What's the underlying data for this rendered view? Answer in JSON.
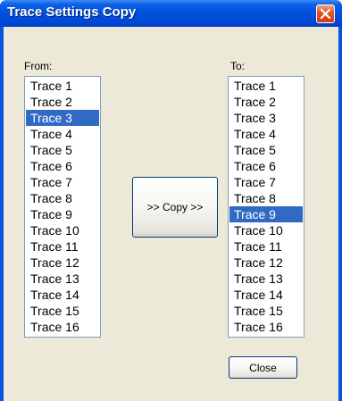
{
  "window": {
    "title": "Trace Settings Copy"
  },
  "from": {
    "label": "From:",
    "items": [
      "Trace 1",
      "Trace 2",
      "Trace 3",
      "Trace 4",
      "Trace 5",
      "Trace 6",
      "Trace 7",
      "Trace 8",
      "Trace 9",
      "Trace 10",
      "Trace 11",
      "Trace 12",
      "Trace 13",
      "Trace 14",
      "Trace 15",
      "Trace 16"
    ],
    "selected_index": 2
  },
  "to": {
    "label": "To:",
    "items": [
      "Trace 1",
      "Trace 2",
      "Trace 3",
      "Trace 4",
      "Trace 5",
      "Trace 6",
      "Trace 7",
      "Trace 8",
      "Trace 9",
      "Trace 10",
      "Trace 11",
      "Trace 12",
      "Trace 13",
      "Trace 14",
      "Trace 15",
      "Trace 16"
    ],
    "selected_index": 8
  },
  "buttons": {
    "copy": ">> Copy >>",
    "close": "Close"
  },
  "icons": {
    "close": "close-icon"
  },
  "colors": {
    "selection": "#316ac5",
    "titlebar": "#0050df",
    "face": "#ece9d8"
  }
}
